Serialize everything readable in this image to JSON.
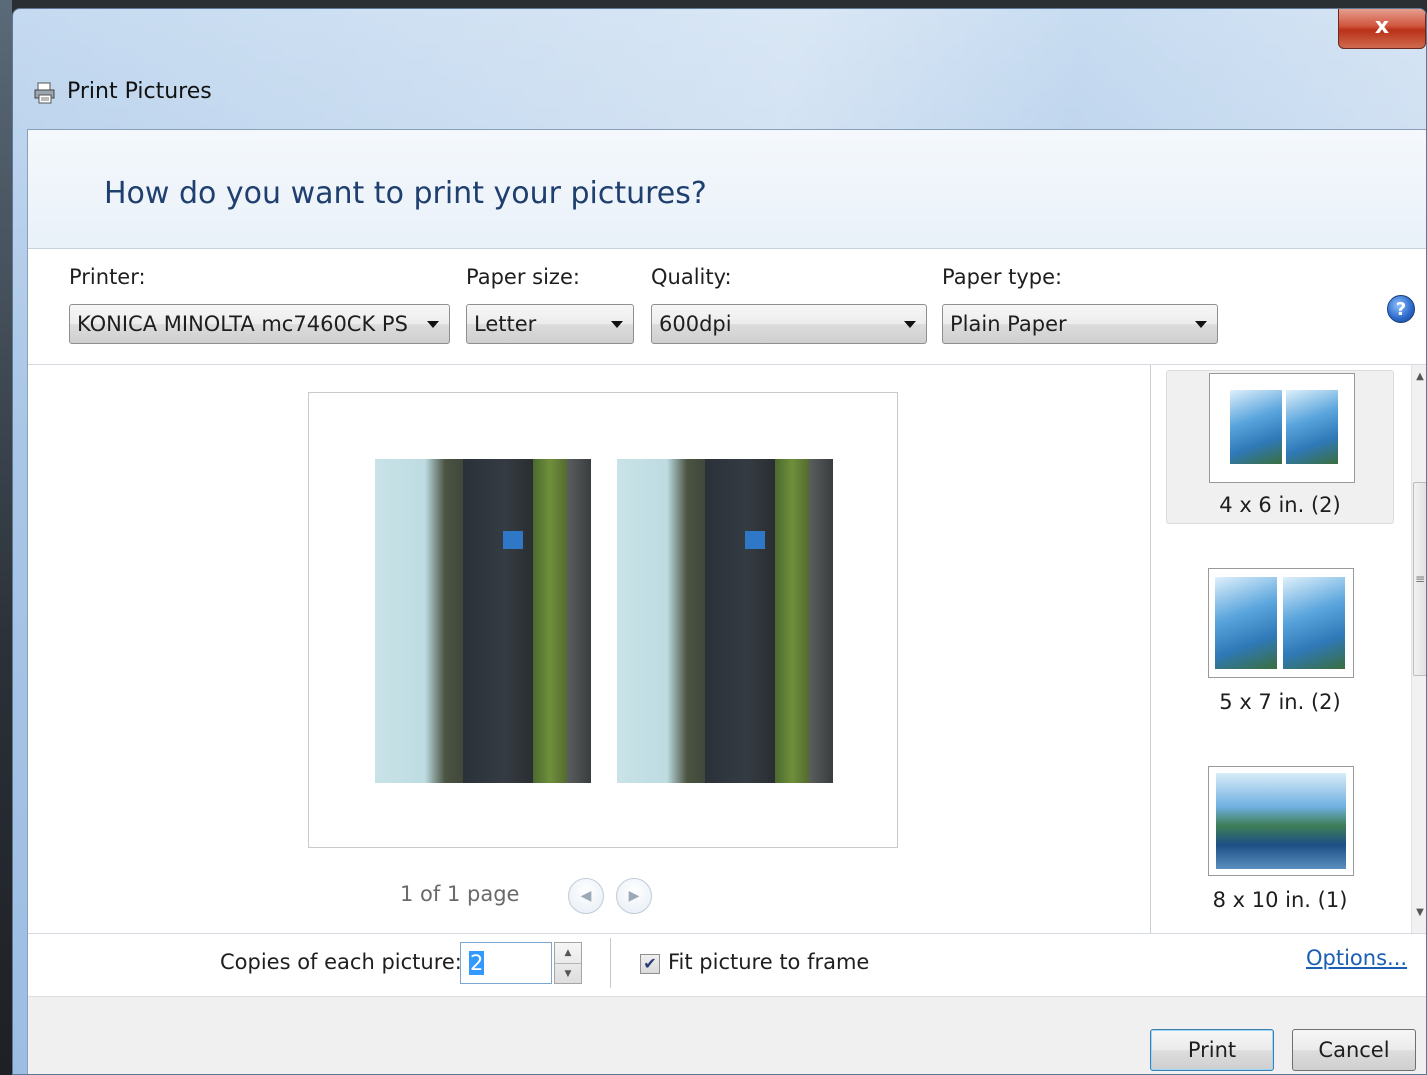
{
  "window": {
    "title": "Print Pictures",
    "close_label": "x"
  },
  "header": {
    "heading": "How do you want to print your pictures?"
  },
  "settings": {
    "printer_label": "Printer:",
    "printer_value": "KONICA MINOLTA mc7460CK PS",
    "paper_size_label": "Paper size:",
    "paper_size_value": "Letter",
    "quality_label": "Quality:",
    "quality_value": "600dpi",
    "paper_type_label": "Paper type:",
    "paper_type_value": "Plain Paper",
    "help_glyph": "?"
  },
  "preview": {
    "page_count": "1 of 1 page",
    "prev_glyph": "◀",
    "next_glyph": "▶"
  },
  "layouts": [
    {
      "label": "4 x 6 in. (2)",
      "selected": true
    },
    {
      "label": "5 x 7 in. (2)",
      "selected": false
    },
    {
      "label": "8 x 10 in. (1)",
      "selected": false
    }
  ],
  "options": {
    "copies_label": "Copies of each picture:",
    "copies_value": "2",
    "fit_label": "Fit picture to frame",
    "fit_checked": true,
    "check_glyph": "✔",
    "options_link": "Options..."
  },
  "buttons": {
    "print": "Print",
    "cancel": "Cancel"
  },
  "colors": {
    "heading": "#1f3f6f",
    "link": "#1a5fb4",
    "close": "#c9432a"
  }
}
